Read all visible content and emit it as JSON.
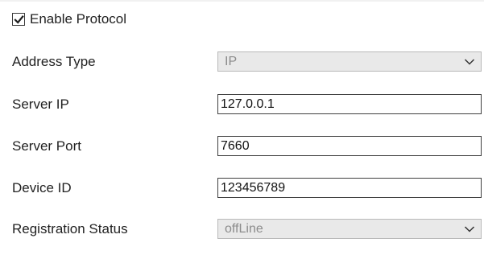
{
  "enable_protocol": {
    "label": "Enable Protocol",
    "checked": true,
    "check_icon": "checkmark-icon"
  },
  "fields": {
    "address_type": {
      "label": "Address Type",
      "value": "IP",
      "icon": "chevron-down-icon"
    },
    "server_ip": {
      "label": "Server IP",
      "value": "127.0.0.1"
    },
    "server_port": {
      "label": "Server Port",
      "value": "7660"
    },
    "device_id": {
      "label": "Device ID",
      "value": "123456789"
    },
    "registration_status": {
      "label": "Registration Status",
      "value": "offLine",
      "icon": "chevron-down-icon"
    }
  },
  "colors": {
    "disabled_select_bg": "#e9e9e9",
    "disabled_text": "#8c8c8c",
    "input_border": "#3f3f3f"
  }
}
